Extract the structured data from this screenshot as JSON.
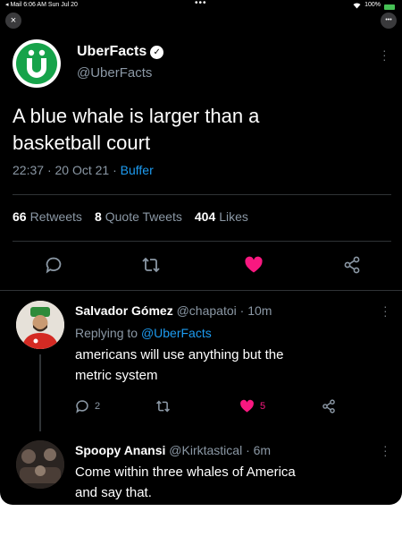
{
  "statusbar": {
    "left": "◂ Mail  6:06 AM  Sun Jul 20",
    "dots": "•••",
    "battery_pct": "100%",
    "battery_color": "#46c155"
  },
  "topbar": {
    "close_icon": "×",
    "more_icon": "•••"
  },
  "tweet": {
    "author_name": "UberFacts",
    "author_handle": "@UberFacts",
    "verified_icon": "✓",
    "avatar_letter": "Ü",
    "text_line1": "A blue whale is larger than a",
    "text_line2": "basketball court",
    "time": "22:37",
    "date": "20 Oct 21",
    "sep": "·",
    "source": "Buffer",
    "stats": {
      "retweets_count": "66",
      "retweets_label": "Retweets",
      "quotes_count": "8",
      "quotes_label": "Quote Tweets",
      "likes_count": "404",
      "likes_label": "Likes"
    },
    "liked": true,
    "accent": "#1d9bf0",
    "like_color": "#f91880"
  },
  "replies": [
    {
      "name": "Salvador Gómez",
      "handle": "@chapatoi",
      "sep": "·",
      "time": "10m",
      "replying_prefix": "Replying to",
      "replying_to": "@UberFacts",
      "text_line1": "americans will use anything but the",
      "text_line2": "metric system",
      "reply_count": "2",
      "like_count": "5",
      "liked": true
    },
    {
      "name": "Spoopy Anansi",
      "handle": "@Kirktastical",
      "sep": "·",
      "time": "6m",
      "text_line1": "Come within three whales of America",
      "text_line2": "and say that."
    }
  ]
}
